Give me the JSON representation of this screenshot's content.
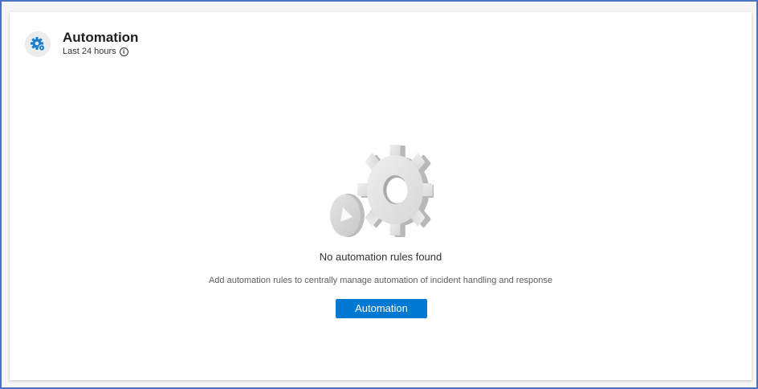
{
  "header": {
    "title": "Automation",
    "subtitle": "Last 24 hours",
    "icon": "automation-gear-icon",
    "info_icon_glyph": "i"
  },
  "empty_state": {
    "illustration": "gear-with-play-icon",
    "title": "No automation rules found",
    "description": "Add automation rules to centrally manage automation of incident handling and response",
    "button_label": "Automation"
  },
  "colors": {
    "frame_border": "#4a72c4",
    "primary_button": "#0078d4",
    "icon_accent": "#0078d4"
  }
}
